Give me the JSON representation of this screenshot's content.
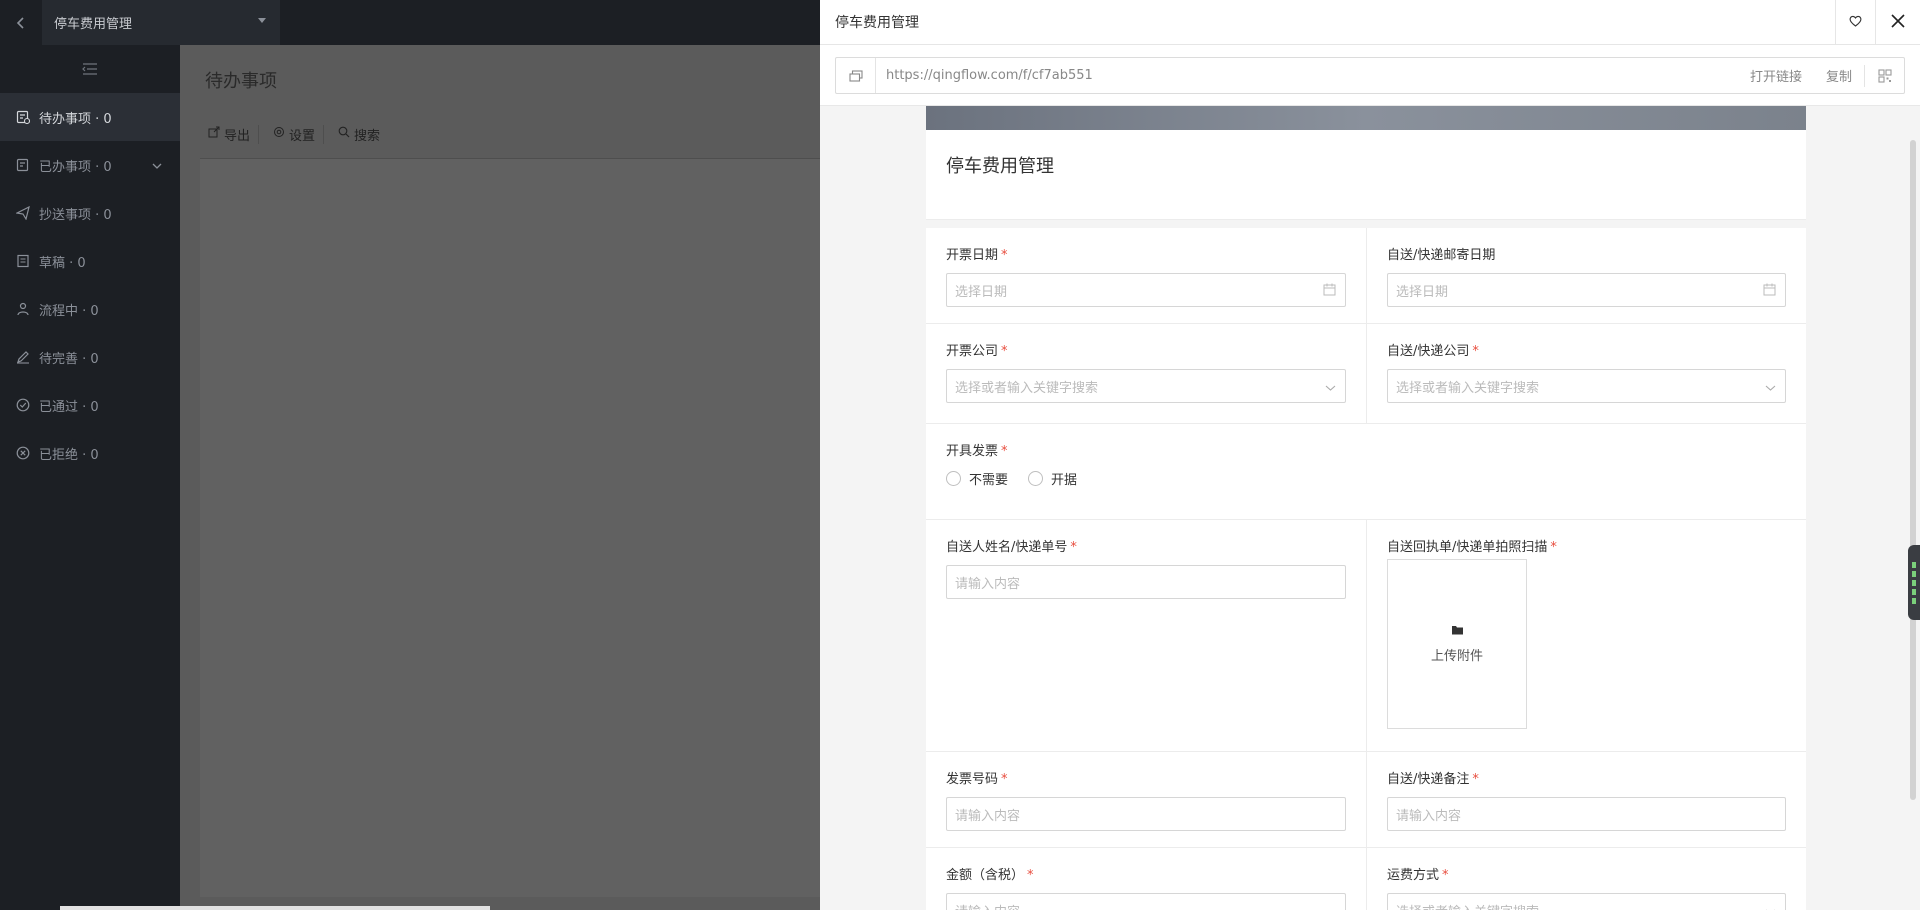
{
  "app": {
    "name": "停车费用管理"
  },
  "sidebar": {
    "items": [
      {
        "label": "待办事项 · 0",
        "icon": "todo-list-icon",
        "active": true
      },
      {
        "label": "已办事项 · 0",
        "icon": "done-list-icon",
        "expandable": true
      },
      {
        "label": "抄送事项 · 0",
        "icon": "paper-plane-icon"
      },
      {
        "label": "草稿 · 0",
        "icon": "draft-icon"
      },
      {
        "label": "流程中 · 0",
        "icon": "flow-icon"
      },
      {
        "label": "待完善 · 0",
        "icon": "edit-icon"
      },
      {
        "label": "已通过 · 0",
        "icon": "check-circle-icon"
      },
      {
        "label": "已拒绝 · 0",
        "icon": "x-circle-icon"
      }
    ]
  },
  "main": {
    "title": "待办事项",
    "toolbar": {
      "export_label": "导出",
      "settings_label": "设置",
      "search_label": "搜索"
    }
  },
  "drawer": {
    "title": "停车费用管理",
    "url": "https://qingflow.com/f/cf7ab551",
    "open_link_label": "打开链接",
    "copy_label": "复制"
  },
  "form": {
    "title": "停车费用管理",
    "fields": {
      "invoice_date": {
        "label": "开票日期",
        "placeholder": "选择日期"
      },
      "delivery_date": {
        "label": "自送/快递邮寄日期",
        "placeholder": "选择日期"
      },
      "invoice_company": {
        "label": "开票公司",
        "placeholder": "选择或者输入关键字搜索"
      },
      "delivery_company": {
        "label": "自送/快递公司",
        "placeholder": "选择或者输入关键字搜索"
      },
      "issue_invoice": {
        "label": "开具发票",
        "options": [
          "不需要",
          "开据"
        ]
      },
      "sender_name": {
        "label": "自送人姓名/快递单号",
        "placeholder": "请输入内容"
      },
      "receipt_scan": {
        "label": "自送回执单/快递单拍照扫描",
        "upload_label": "上传附件"
      },
      "invoice_number": {
        "label": "发票号码",
        "placeholder": "请输入内容"
      },
      "delivery_note": {
        "label": "自送/快递备注",
        "placeholder": "请输入内容"
      },
      "amount": {
        "label": "金额（含税）",
        "placeholder": "请输入内容"
      },
      "shipping_method": {
        "label": "运费方式",
        "placeholder": "选择或者输入关键字搜索"
      }
    },
    "required_mark": "*"
  }
}
